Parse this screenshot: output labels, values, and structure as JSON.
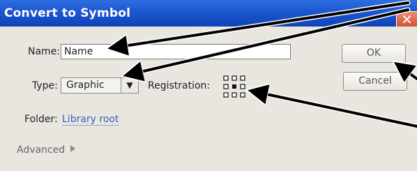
{
  "dialog": {
    "title": "Convert to Symbol",
    "close_glyph": "✕",
    "name_label": "Name:",
    "name_value": "Name",
    "type_label": "Type:",
    "type_value": "Graphic",
    "dropdown_glyph": "▼",
    "registration_label": "Registration:",
    "folder_label": "Folder:",
    "folder_value": "Library root",
    "advanced_label": "Advanced",
    "ok_label": "OK",
    "cancel_label": "Cancel"
  },
  "icons": [
    "close-icon",
    "dropdown-arrow-icon",
    "registration-grid-icon",
    "expand-triangle-icon"
  ],
  "colors": {
    "titlebar": "#1d57d1",
    "dialog_bg": "#e8e6df",
    "link": "#3a63b8",
    "close_button": "#d5512e"
  }
}
